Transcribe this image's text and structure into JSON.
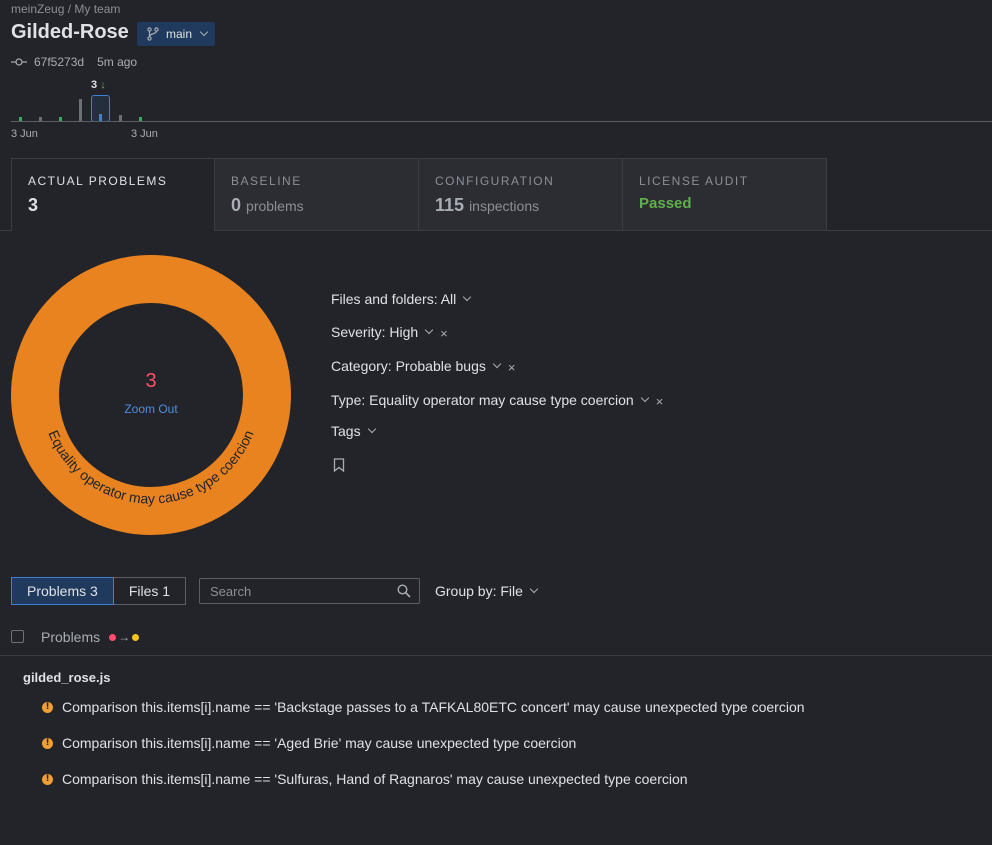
{
  "header": {
    "breadcrumb": "meinZeug / My team",
    "title": "Gilded-Rose",
    "branch": "main",
    "commit_hash": "67f5273d",
    "commit_time": "5m ago"
  },
  "timeline": {
    "selected_count": "3",
    "selected_arrow": "↓",
    "date_labels": [
      "3 Jun",
      "3 Jun"
    ]
  },
  "tabs": [
    {
      "label": "ACTUAL PROBLEMS",
      "value": "3",
      "unit": ""
    },
    {
      "label": "BASELINE",
      "value": "0",
      "unit": "problems"
    },
    {
      "label": "CONFIGURATION",
      "value": "115",
      "unit": "inspections"
    },
    {
      "label": "LICENSE AUDIT",
      "value": "Passed",
      "unit": ""
    }
  ],
  "donut": {
    "count": "3",
    "zoom_label": "Zoom Out",
    "segment_label": "Equality operator may cause type coercion",
    "segment_color": "#e8831f",
    "count_color": "#ff4d6d"
  },
  "filters": {
    "files": "Files and folders: All",
    "severity": "Severity: High",
    "category": "Category: Probable bugs",
    "type": "Type: Equality operator may cause type coercion",
    "tags": "Tags",
    "bookmark_icon": "bookmark-icon",
    "remove_symbol": "×"
  },
  "list": {
    "problems_tab": "Problems 3",
    "files_tab": "Files 1",
    "search_placeholder": "Search",
    "group_by": "Group by: File",
    "header_label": "Problems",
    "severity_arrow": "→",
    "severity_colors": [
      "#ff4d6d",
      "#f5c518"
    ],
    "file": "gilded_rose.js",
    "problems": [
      "Comparison this.items[i].name == 'Backstage passes to a TAFKAL80ETC concert' may cause unexpected type coercion",
      "Comparison this.items[i].name == 'Aged Brie' may cause unexpected type coercion",
      "Comparison this.items[i].name == 'Sulfuras, Hand of Ragnaros' may cause unexpected type coercion"
    ],
    "warning_icon": "!"
  }
}
